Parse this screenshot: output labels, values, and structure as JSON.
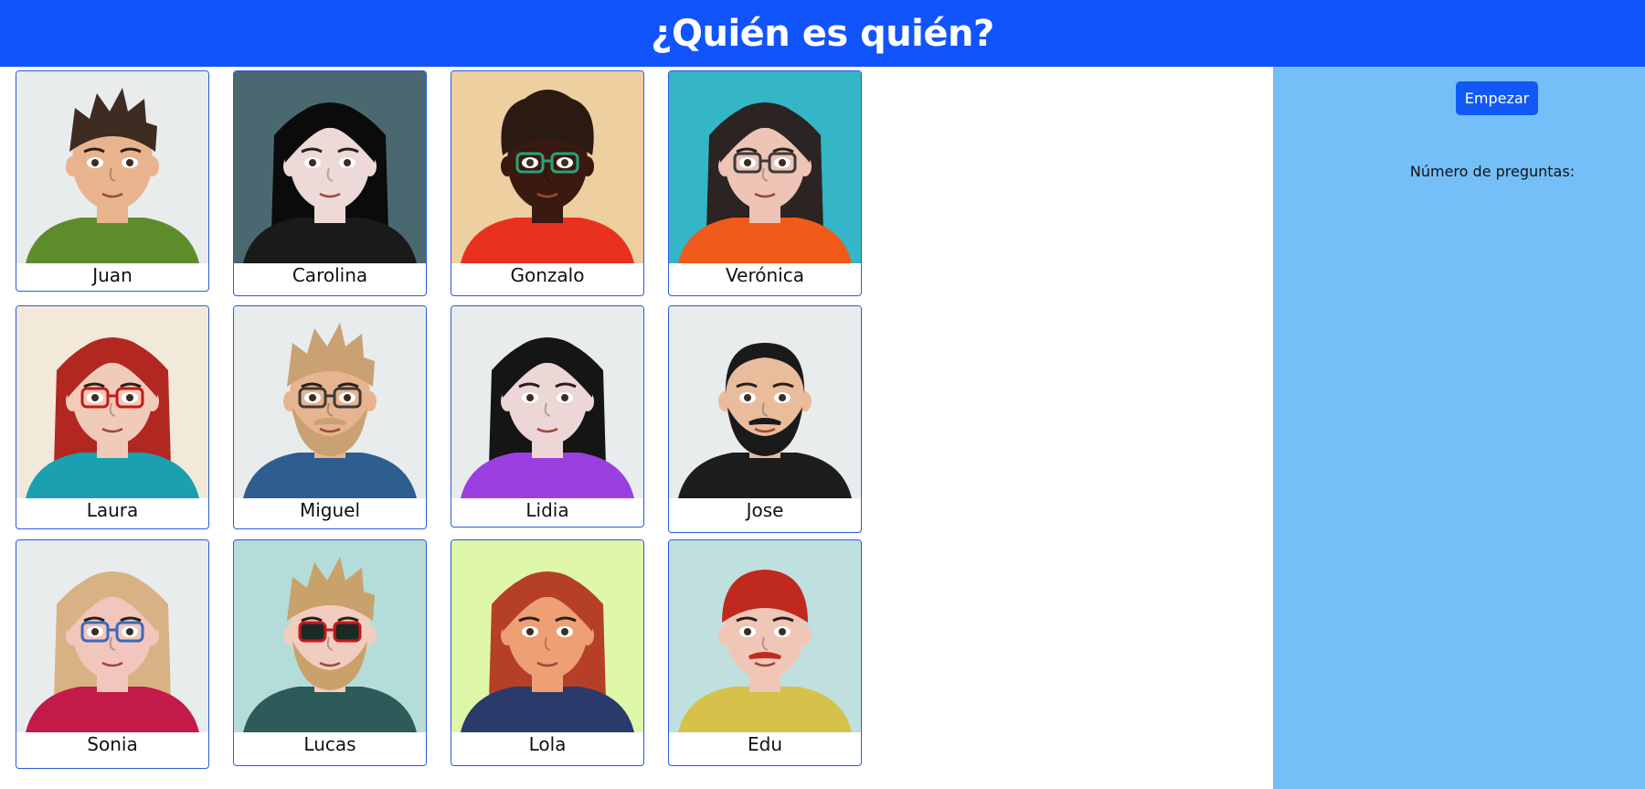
{
  "header": {
    "title": "¿Quién es quién?"
  },
  "sidebar": {
    "start_label": "Empezar",
    "questions_label": "Número de preguntas:"
  },
  "characters": [
    {
      "name": "Juan",
      "bg": "#e8ecec",
      "skin": "#e9b48d",
      "hair": "#3e2b22",
      "shirt": "#5f8c2a",
      "hairStyle": "spiky",
      "glasses": "none",
      "beard": false,
      "mustache": false
    },
    {
      "name": "Carolina",
      "bg": "#4a6870",
      "skin": "#ecd9d8",
      "hair": "#0b0b0b",
      "shirt": "#1a1a1a",
      "hairStyle": "long",
      "glasses": "none",
      "beard": false,
      "mustache": false
    },
    {
      "name": "Gonzalo",
      "bg": "#edcfa0",
      "skin": "#3a1a10",
      "hair": "#2b1a12",
      "shirt": "#e8321e",
      "hairStyle": "curly",
      "glasses": "green",
      "beard": false,
      "mustache": false
    },
    {
      "name": "Verónica",
      "bg": "#34b6c7",
      "skin": "#edc4b6",
      "hair": "#2b2422",
      "shirt": "#f05a1a",
      "hairStyle": "long",
      "glasses": "dark",
      "beard": false,
      "mustache": false
    },
    {
      "name": "Laura",
      "bg": "#f3e9db",
      "skin": "#f1cbb9",
      "hair": "#b22820",
      "shirt": "#1aa0b0",
      "hairStyle": "long",
      "glasses": "red",
      "beard": false,
      "mustache": false
    },
    {
      "name": "Miguel",
      "bg": "#e8ecec",
      "skin": "#e6b48f",
      "hair": "#c9a172",
      "shirt": "#2d5e8f",
      "hairStyle": "spiky",
      "glasses": "dark",
      "beard": true,
      "mustache": true
    },
    {
      "name": "Lidia",
      "bg": "#e8ecec",
      "skin": "#ecd6d6",
      "hair": "#151515",
      "shirt": "#9b3fe0",
      "hairStyle": "long",
      "glasses": "none",
      "beard": false,
      "mustache": false
    },
    {
      "name": "Jose",
      "bg": "#e8ecec",
      "skin": "#e9bc9c",
      "hair": "#1a1a1a",
      "shirt": "#1d1d1d",
      "hairStyle": "bald",
      "glasses": "none",
      "beard": true,
      "mustache": true
    },
    {
      "name": "Sonia",
      "bg": "#e8ecec",
      "skin": "#f1c6bc",
      "hair": "#d8b285",
      "shirt": "#c41a4a",
      "hairStyle": "long",
      "glasses": "blue",
      "beard": false,
      "mustache": false
    },
    {
      "name": "Lucas",
      "bg": "#b4dcd9",
      "skin": "#f1cdbf",
      "hair": "#c9a16b",
      "shirt": "#2c5b5a",
      "hairStyle": "spiky",
      "glasses": "sun",
      "beard": true,
      "mustache": false
    },
    {
      "name": "Lola",
      "bg": "#dff7a8",
      "skin": "#ef9f74",
      "hair": "#b63f28",
      "shirt": "#2a3a6a",
      "hairStyle": "long",
      "glasses": "none",
      "beard": false,
      "mustache": false
    },
    {
      "name": "Edu",
      "bg": "#bfe0de",
      "skin": "#f0c7b6",
      "hair": "#c02a1e",
      "shirt": "#d6c24a",
      "hairStyle": "short",
      "glasses": "none",
      "beard": false,
      "mustache": true
    }
  ]
}
